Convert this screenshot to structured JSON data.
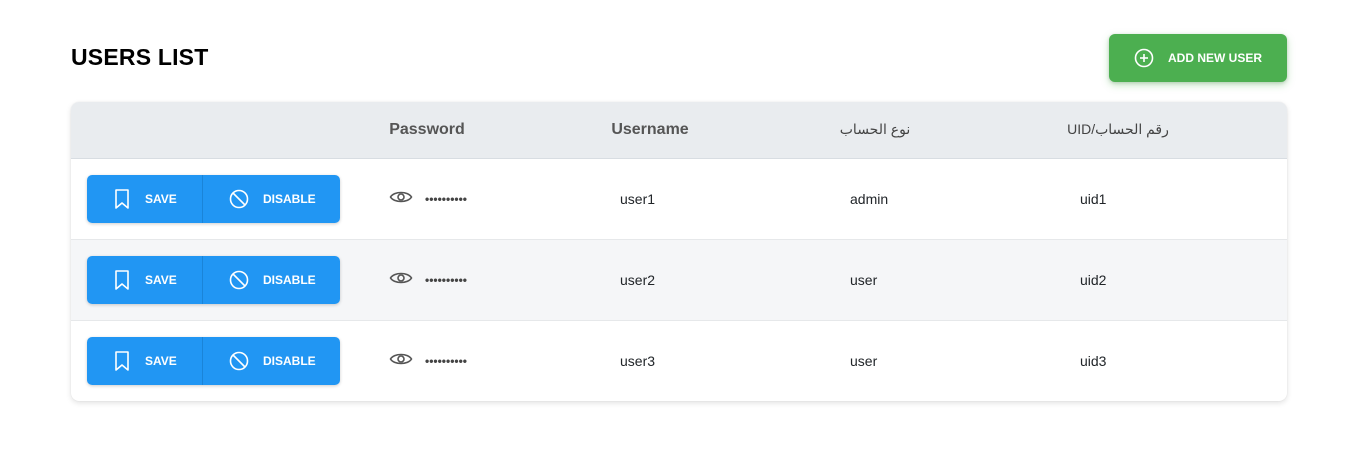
{
  "header": {
    "title": "USERS LIST",
    "add_button_label": "ADD NEW USER"
  },
  "table": {
    "columns": [
      "",
      "Password",
      "Username",
      "نوع الحساب",
      "UID/رقم الحساب"
    ],
    "rows": [
      {
        "save_label": "SAVE",
        "disable_label": "DISABLE",
        "password": "••••••••••",
        "username": "user1",
        "type": "admin",
        "uid": "uid1"
      },
      {
        "save_label": "SAVE",
        "disable_label": "DISABLE",
        "password": "••••••••••",
        "username": "user2",
        "type": "user",
        "uid": "uid2"
      },
      {
        "save_label": "SAVE",
        "disable_label": "DISABLE",
        "password": "••••••••••",
        "username": "user3",
        "type": "user",
        "uid": "uid3"
      }
    ]
  },
  "colors": {
    "add_button": "#4caf50",
    "action_button": "#2196f3",
    "header_bg": "#e9ecef"
  },
  "icons": {
    "add": "plus-circle-icon",
    "save": "bookmark-icon",
    "disable": "block-icon",
    "password": "eye-icon"
  }
}
